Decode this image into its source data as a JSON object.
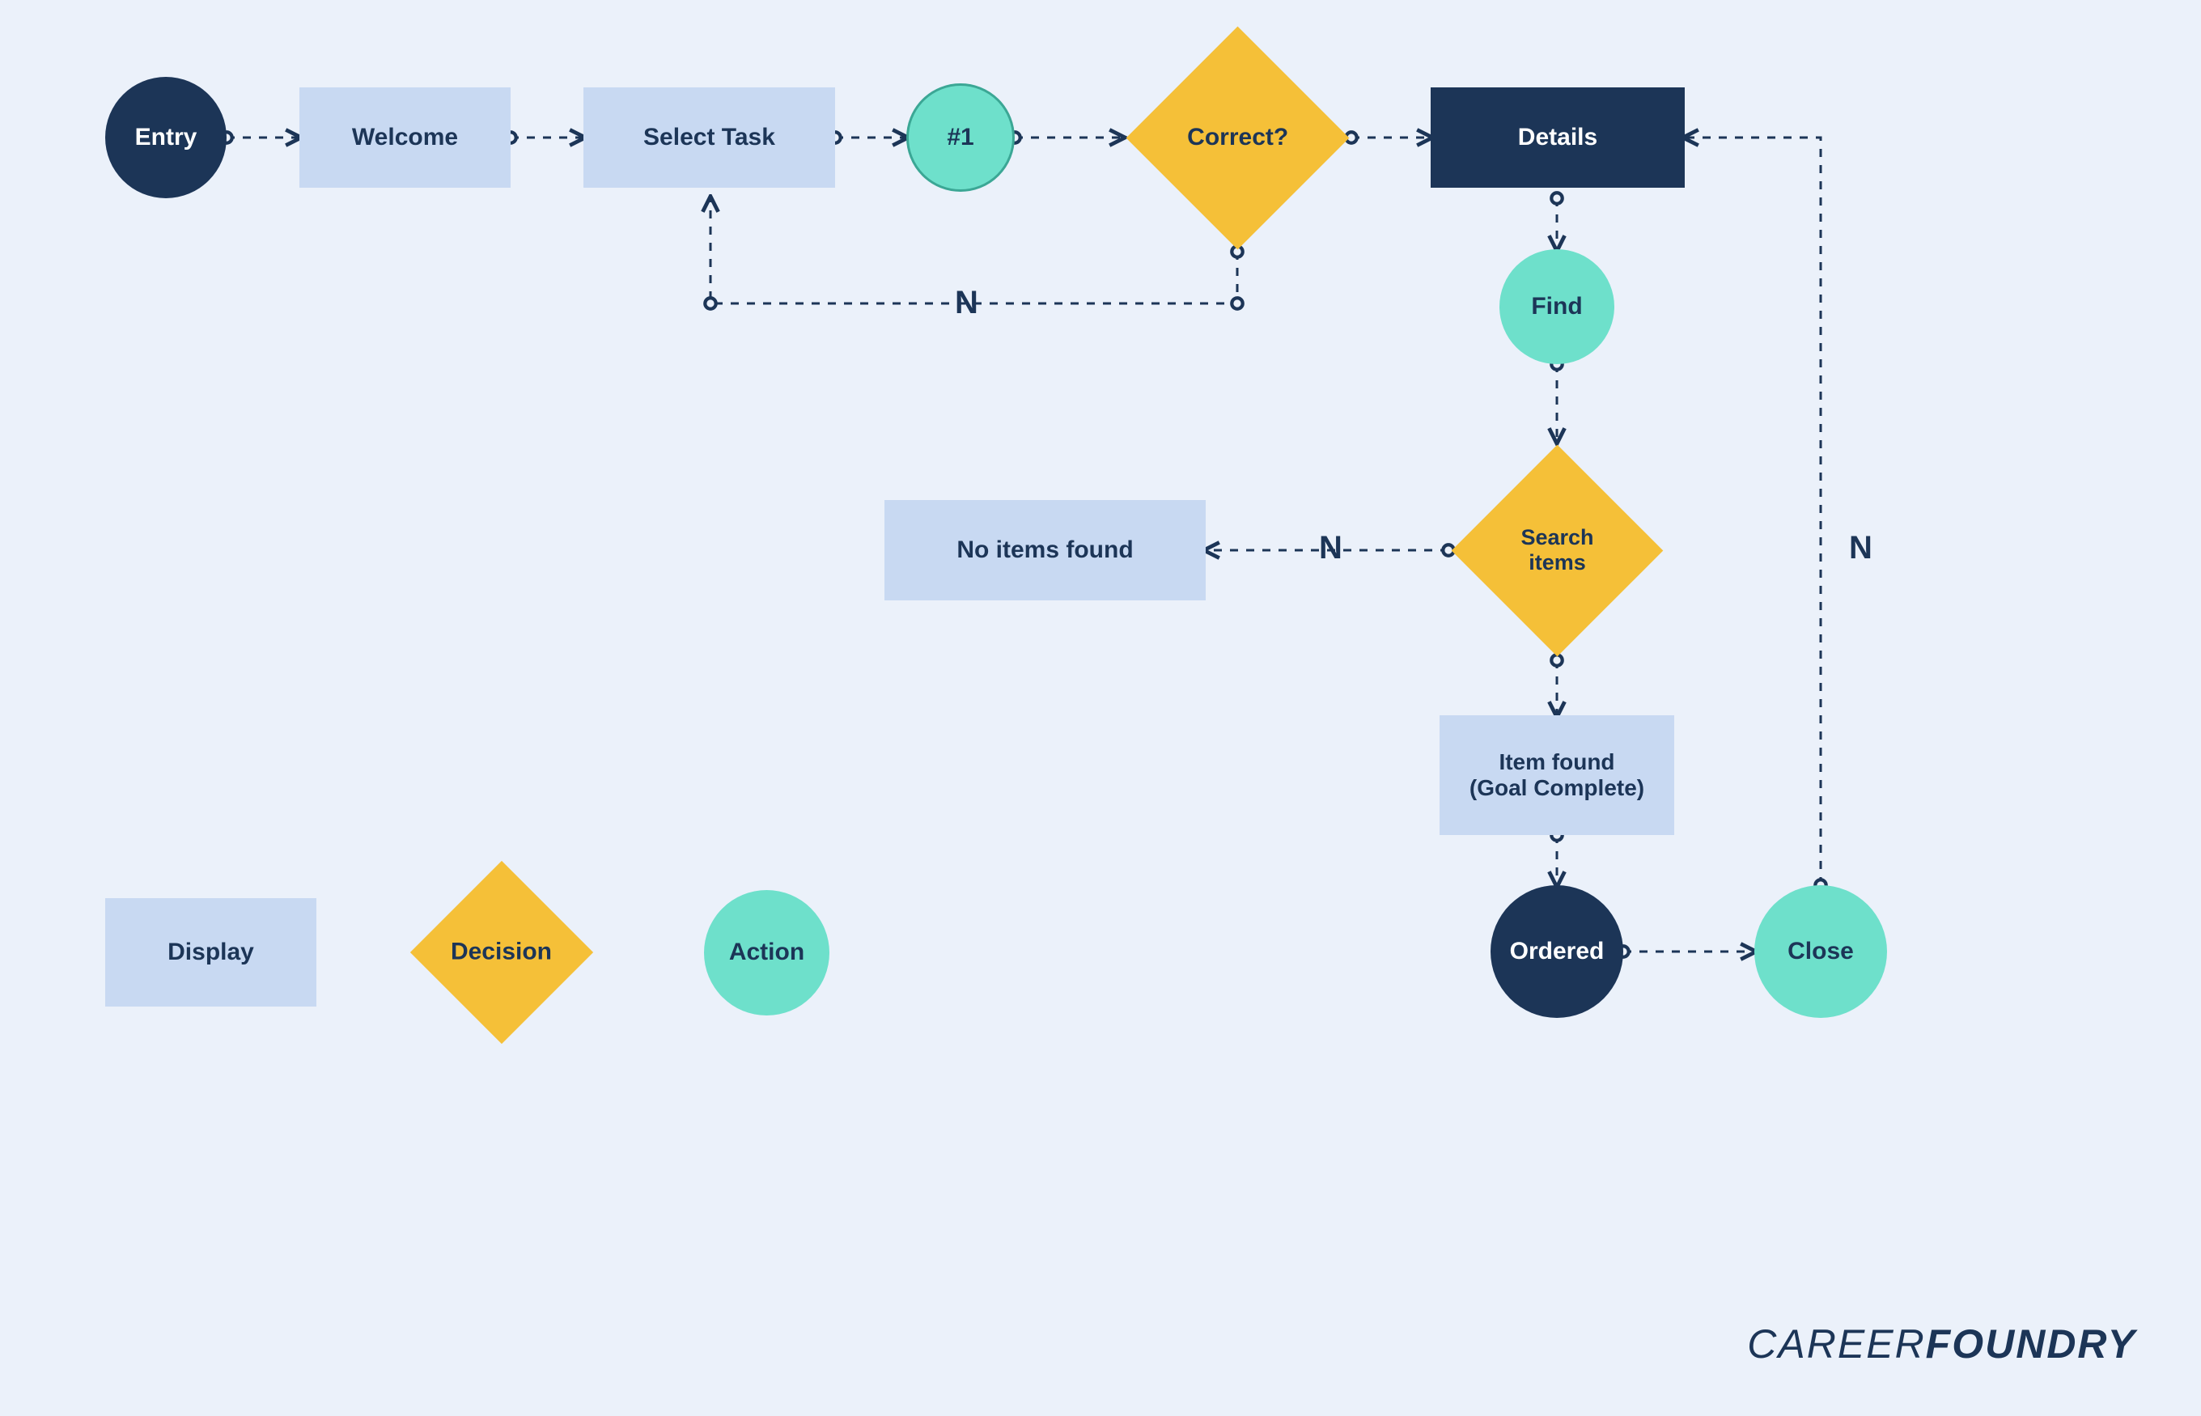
{
  "colors": {
    "background": "#EBF1FA",
    "navy": "#1C3557",
    "blue_box": "#C8D9F2",
    "teal": "#6EE0CB",
    "teal_dark": "#3BA795",
    "gold": "#F5C038"
  },
  "nodes": {
    "entry": "Entry",
    "welcome": "Welcome",
    "select_task": "Select Task",
    "ref1": "#1",
    "correct": "Correct?",
    "details": "Details",
    "find": "Find",
    "search_items": "Search\nitems",
    "no_items_found": "No items found",
    "item_found": "Item found\n(Goal Complete)",
    "ordered": "Ordered",
    "close": "Close"
  },
  "edge_labels": {
    "correct_no": "N",
    "search_no": "N",
    "close_no": "N"
  },
  "legend": {
    "display": "Display",
    "decision": "Decision",
    "action": "Action"
  },
  "logo": {
    "part1": "CAREER",
    "part2": "FOUNDRY"
  },
  "diagram_semantics": {
    "description": "User task flowchart showing a sequence from entry through task selection, decision points, search, and ordering, with branches on 'Correct?' and 'Search items'.",
    "node_types": {
      "Entry": "entry-circle-navy",
      "Welcome": "display-rect-blue",
      "Select Task": "display-rect-blue",
      "#1": "action-circle-teal-bordered",
      "Correct?": "decision-diamond-gold",
      "Details": "display-rect-navy",
      "Find": "action-circle-teal",
      "Search items": "decision-diamond-gold",
      "No items found": "display-rect-blue",
      "Item found (Goal Complete)": "display-rect-blue",
      "Ordered": "entry-circle-navy",
      "Close": "action-circle-teal"
    },
    "edges": [
      {
        "from": "Entry",
        "to": "Welcome"
      },
      {
        "from": "Welcome",
        "to": "Select Task"
      },
      {
        "from": "Select Task",
        "to": "#1"
      },
      {
        "from": "#1",
        "to": "Correct?"
      },
      {
        "from": "Correct?",
        "to": "Details"
      },
      {
        "from": "Correct?",
        "to": "Select Task",
        "label": "N"
      },
      {
        "from": "Details",
        "to": "Find"
      },
      {
        "from": "Find",
        "to": "Search items"
      },
      {
        "from": "Search items",
        "to": "No items found",
        "label": "N"
      },
      {
        "from": "Search items",
        "to": "Item found (Goal Complete)"
      },
      {
        "from": "Item found (Goal Complete)",
        "to": "Ordered"
      },
      {
        "from": "Ordered",
        "to": "Close"
      },
      {
        "from": "Close",
        "to": "Details",
        "label": "N"
      }
    ],
    "legend_mapping": {
      "Display": "rect-blue",
      "Decision": "diamond-gold",
      "Action": "circle-teal"
    }
  }
}
